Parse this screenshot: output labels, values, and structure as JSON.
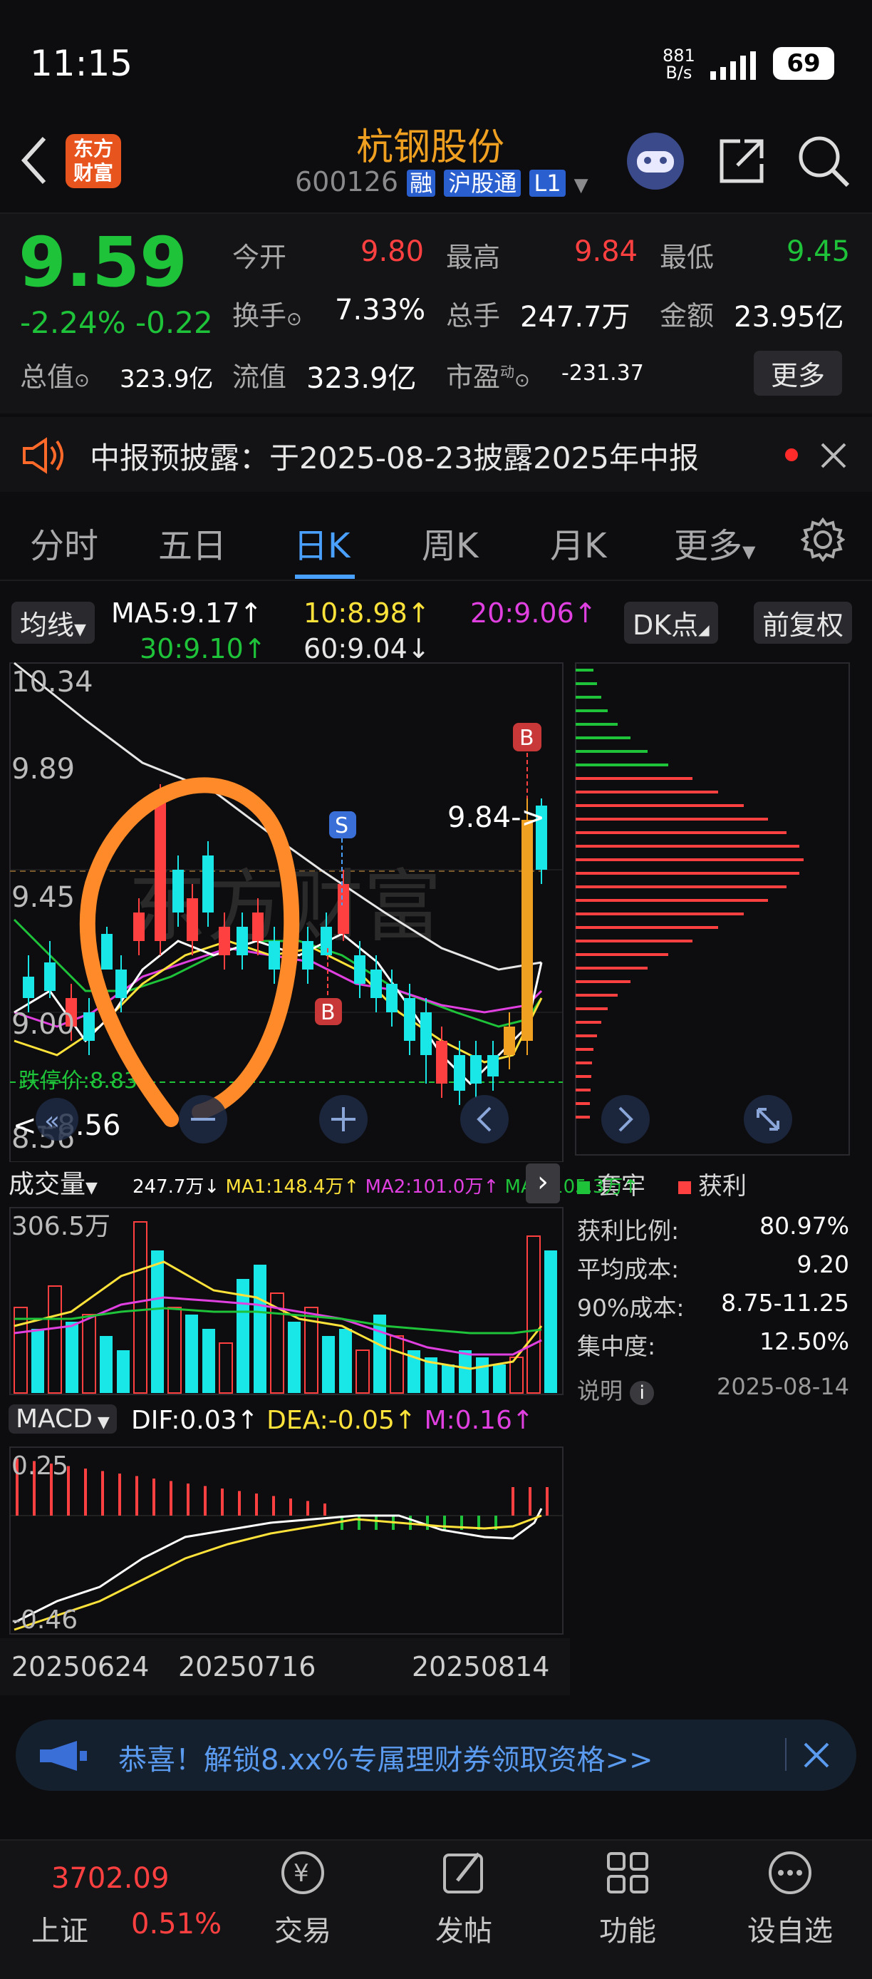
{
  "status": {
    "time": "11:15",
    "net_top": "881",
    "net_bottom": "B/s",
    "battery": "69"
  },
  "header": {
    "title": "杭钢股份",
    "code": "600126",
    "badge_rong": "融",
    "badge_hgt": "沪股通",
    "badge_level": "L1",
    "logo_line1": "东方",
    "logo_line2": "财富"
  },
  "quote": {
    "price": "9.59",
    "change_pct": "-2.24%",
    "change": "-0.22",
    "open_label": "今开",
    "open": "9.80",
    "high_label": "最高",
    "high": "9.84",
    "low_label": "最低",
    "low": "9.45",
    "turnover_label": "换手",
    "turnover": "7.33%",
    "volume_label": "总手",
    "volume": "247.7万",
    "amount_label": "金额",
    "amount": "23.95亿",
    "mcap_label": "总值",
    "mcap": "323.9亿",
    "float_label": "流值",
    "float": "323.9亿",
    "pe_label": "市盈",
    "pe_sup": "动",
    "pe": "-231.37",
    "more": "更多"
  },
  "notice": {
    "text": "中报预披露：于2025-08-23披露2025年中报"
  },
  "tabs": [
    "分时",
    "五日",
    "日K",
    "周K",
    "月K",
    "更多"
  ],
  "ma_bar": {
    "selector": "均线",
    "ma5": "MA5:9.17↑",
    "ma10": "10:8.98↑",
    "ma20": "20:9.06↑",
    "ma30": "30:9.10↑",
    "ma60": "60:9.04↓",
    "dk": "DK点",
    "fq": "前复权"
  },
  "kline": {
    "y_top": "10.34",
    "y_2": "9.89",
    "y_3": "9.45",
    "y_4": "9.00",
    "y_bottom": "8.56",
    "high_marker": "9.84",
    "low_marker": "8.56",
    "limit_down": "跌停价:8.83",
    "signal_b1": "B",
    "signal_s": "S",
    "signal_b2": "B"
  },
  "chip_dist": {
    "legend_trapped": "套牢",
    "legend_profit": "获利",
    "rows": [
      {
        "label": "获利比例:",
        "value": "80.97%"
      },
      {
        "label": "平均成本:",
        "value": "9.20"
      },
      {
        "label": "90%成本:",
        "value": "8.75-11.25"
      },
      {
        "label": "集中度:",
        "value": "12.50%"
      }
    ],
    "note_label": "说明",
    "date": "2025-08-14"
  },
  "volume_bar": {
    "selector": "成交量",
    "vol": "247.7万↓",
    "ma1": "MA1:148.4万↑",
    "ma2": "MA2:101.0万↑",
    "ma3": "MA3:105.3万↑",
    "y_max": "306.5万"
  },
  "macd_bar": {
    "selector": "MACD",
    "dif": "DIF:0.03↑",
    "dea": "DEA:-0.05↑",
    "m": "M:0.16↑",
    "y_top": "0.25",
    "y_bottom": "-0.46"
  },
  "dates": [
    "20250624",
    "20250716",
    "20250814"
  ],
  "banner": {
    "text": "恭喜！解锁8.xx%专属理财券领取资格>>"
  },
  "bottom_nav": {
    "index_name": "上证",
    "index_value": "3702.09",
    "index_change": "0.51%",
    "items": [
      "交易",
      "发帖",
      "功能",
      "设自选"
    ]
  },
  "colors": {
    "up": "#ff4040",
    "down": "#19e6e6",
    "accent": "#4aa0ff",
    "orange": "#ff8a2a"
  }
}
